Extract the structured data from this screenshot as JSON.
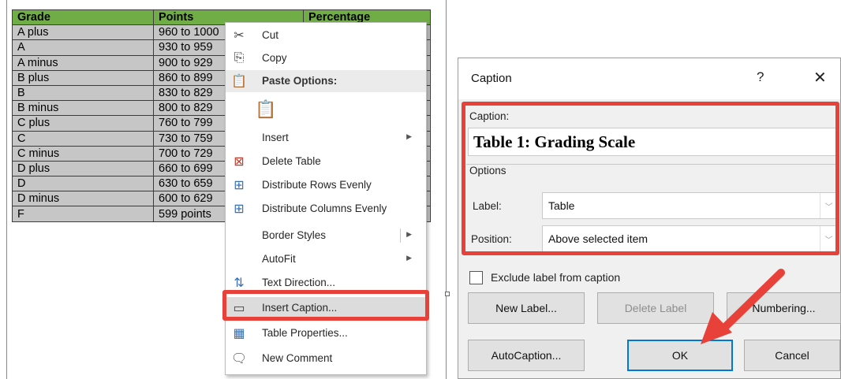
{
  "table": {
    "headers": [
      "Grade",
      "Points",
      "Percentage"
    ],
    "rows": [
      [
        "A plus",
        "960 to 1000"
      ],
      [
        "A",
        "930 to 959"
      ],
      [
        "A minus",
        "900 to 929"
      ],
      [
        "B plus",
        "860 to 899"
      ],
      [
        "B",
        "830 to 829"
      ],
      [
        "B minus",
        "800 to 829"
      ],
      [
        "C plus",
        "760 to 799"
      ],
      [
        "C",
        "730 to 759"
      ],
      [
        "C minus",
        "700 to 729"
      ],
      [
        "D plus",
        "660 to 699"
      ],
      [
        "D",
        "630 to 659"
      ],
      [
        "D minus",
        "600 to 629"
      ],
      [
        "F",
        "599 points"
      ]
    ]
  },
  "context_menu": {
    "items": [
      {
        "label": "Cut",
        "icon": "scissors-icon",
        "glyph": "✂",
        "type": "item"
      },
      {
        "label": "Copy",
        "icon": "copy-icon",
        "glyph": "⎘",
        "type": "item"
      },
      {
        "label": "Paste Options:",
        "icon": "paste-icon",
        "glyph": "📋",
        "type": "header"
      },
      {
        "label": "",
        "icon": "paste-keep-formatting-icon",
        "glyph": "📋",
        "type": "paste-option"
      },
      {
        "label": "Insert",
        "icon": "",
        "glyph": "",
        "type": "submenu"
      },
      {
        "label": "Delete Table",
        "icon": "delete-table-icon",
        "glyph": "⊠",
        "type": "item"
      },
      {
        "label": "Distribute Rows Evenly",
        "icon": "distribute-rows-icon",
        "glyph": "⊞",
        "type": "item"
      },
      {
        "label": "Distribute Columns Evenly",
        "icon": "distribute-columns-icon",
        "glyph": "⊞",
        "type": "item"
      },
      {
        "label": "Border Styles",
        "icon": "",
        "glyph": "",
        "type": "split-submenu"
      },
      {
        "label": "AutoFit",
        "icon": "",
        "glyph": "",
        "type": "submenu"
      },
      {
        "label": "Text Direction...",
        "icon": "text-direction-icon",
        "glyph": "⇅",
        "type": "item"
      },
      {
        "label": "Insert Caption...",
        "icon": "insert-caption-icon",
        "glyph": "▭",
        "type": "item"
      },
      {
        "label": "Table Properties...",
        "icon": "table-properties-icon",
        "glyph": "▦",
        "type": "item"
      },
      {
        "label": "New Comment",
        "icon": "new-comment-icon",
        "glyph": "🗨",
        "type": "item"
      }
    ]
  },
  "dialog": {
    "title": "Caption",
    "help": "?",
    "close": "✕",
    "caption_label": "Caption:",
    "caption_value": "Table 1: Grading Scale",
    "options_legend": "Options",
    "label_label": "Label:",
    "label_value": "Table",
    "position_label": "Position:",
    "position_value": "Above selected item",
    "exclude_label": "Exclude label from caption",
    "buttons": {
      "new_label": "New Label...",
      "delete_label": "Delete Label",
      "numbering": "Numbering...",
      "autocaption": "AutoCaption...",
      "ok": "OK",
      "cancel": "Cancel"
    }
  },
  "colors": {
    "header_fill": "#70ad47",
    "cell_fill": "#c6c6c6",
    "highlight": "#e8413a",
    "ok_border": "#0078d7"
  }
}
